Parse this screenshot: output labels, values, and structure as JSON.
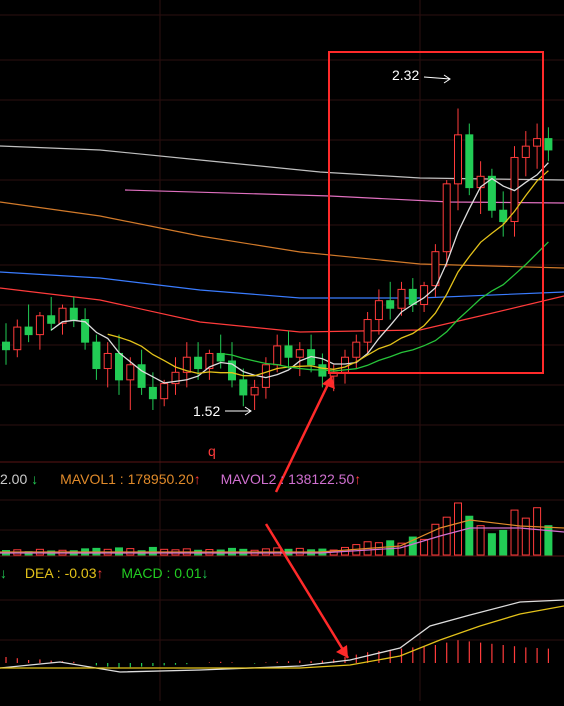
{
  "header_top": {
    "text": ""
  },
  "annotations": {
    "high_price": "2.32",
    "low_price": "1.52",
    "marker": "q"
  },
  "volume_header": {
    "prev_value": "2.00",
    "prev_arrow": "↓",
    "mavol1_label": "MAVOL1 : 178950.20",
    "mavol1_arrow": "↑",
    "mavol2_label": "MAVOL2 : 138122.50",
    "mavol2_arrow": "↑"
  },
  "macd_header": {
    "lead_arrow": "↓",
    "dea_label": "DEA : -0.03",
    "dea_arrow": "↑",
    "macd_label": "MACD : 0.01",
    "macd_arrow": "↓"
  },
  "colors": {
    "up": "#ff3b3b",
    "down": "#22cc55",
    "ma5": "#dddddd",
    "ma10": "#e3c21a",
    "ma20": "#27c43a",
    "ma30": "#e070c0",
    "ma60": "#3a7cff",
    "ma120": "#d27a2a",
    "ma250": "#c0c0c0",
    "highlight": "#ff2a2a",
    "mavol1": "#e08a2a",
    "mavol2": "#d070d0",
    "dea": "#e3c21a",
    "macd": "#22cc22"
  },
  "chart_data": {
    "type": "candlestick",
    "note": "",
    "candles": [
      {
        "o": 1.7,
        "h": 1.75,
        "l": 1.64,
        "c": 1.68
      },
      {
        "o": 1.68,
        "h": 1.76,
        "l": 1.66,
        "c": 1.74
      },
      {
        "o": 1.74,
        "h": 1.8,
        "l": 1.7,
        "c": 1.72
      },
      {
        "o": 1.72,
        "h": 1.78,
        "l": 1.68,
        "c": 1.77
      },
      {
        "o": 1.77,
        "h": 1.82,
        "l": 1.73,
        "c": 1.75
      },
      {
        "o": 1.75,
        "h": 1.8,
        "l": 1.72,
        "c": 1.79
      },
      {
        "o": 1.79,
        "h": 1.82,
        "l": 1.74,
        "c": 1.76
      },
      {
        "o": 1.76,
        "h": 1.79,
        "l": 1.68,
        "c": 1.7
      },
      {
        "o": 1.7,
        "h": 1.72,
        "l": 1.6,
        "c": 1.63
      },
      {
        "o": 1.63,
        "h": 1.7,
        "l": 1.58,
        "c": 1.67
      },
      {
        "o": 1.67,
        "h": 1.72,
        "l": 1.56,
        "c": 1.6
      },
      {
        "o": 1.6,
        "h": 1.66,
        "l": 1.52,
        "c": 1.64
      },
      {
        "o": 1.64,
        "h": 1.68,
        "l": 1.56,
        "c": 1.58
      },
      {
        "o": 1.58,
        "h": 1.62,
        "l": 1.52,
        "c": 1.55
      },
      {
        "o": 1.55,
        "h": 1.6,
        "l": 1.53,
        "c": 1.59
      },
      {
        "o": 1.59,
        "h": 1.66,
        "l": 1.56,
        "c": 1.62
      },
      {
        "o": 1.62,
        "h": 1.7,
        "l": 1.58,
        "c": 1.66
      },
      {
        "o": 1.66,
        "h": 1.7,
        "l": 1.6,
        "c": 1.63
      },
      {
        "o": 1.63,
        "h": 1.68,
        "l": 1.6,
        "c": 1.67
      },
      {
        "o": 1.67,
        "h": 1.72,
        "l": 1.63,
        "c": 1.65
      },
      {
        "o": 1.65,
        "h": 1.7,
        "l": 1.58,
        "c": 1.6
      },
      {
        "o": 1.6,
        "h": 1.63,
        "l": 1.53,
        "c": 1.56
      },
      {
        "o": 1.56,
        "h": 1.6,
        "l": 1.52,
        "c": 1.58
      },
      {
        "o": 1.58,
        "h": 1.66,
        "l": 1.55,
        "c": 1.64
      },
      {
        "o": 1.64,
        "h": 1.72,
        "l": 1.62,
        "c": 1.69
      },
      {
        "o": 1.69,
        "h": 1.73,
        "l": 1.63,
        "c": 1.66
      },
      {
        "o": 1.66,
        "h": 1.7,
        "l": 1.61,
        "c": 1.68
      },
      {
        "o": 1.68,
        "h": 1.72,
        "l": 1.62,
        "c": 1.64
      },
      {
        "o": 1.64,
        "h": 1.67,
        "l": 1.58,
        "c": 1.61
      },
      {
        "o": 1.61,
        "h": 1.64,
        "l": 1.57,
        "c": 1.62
      },
      {
        "o": 1.62,
        "h": 1.68,
        "l": 1.59,
        "c": 1.66
      },
      {
        "o": 1.66,
        "h": 1.72,
        "l": 1.63,
        "c": 1.7
      },
      {
        "o": 1.7,
        "h": 1.78,
        "l": 1.67,
        "c": 1.76
      },
      {
        "o": 1.76,
        "h": 1.84,
        "l": 1.72,
        "c": 1.81
      },
      {
        "o": 1.81,
        "h": 1.86,
        "l": 1.76,
        "c": 1.79
      },
      {
        "o": 1.79,
        "h": 1.86,
        "l": 1.77,
        "c": 1.84
      },
      {
        "o": 1.84,
        "h": 1.87,
        "l": 1.78,
        "c": 1.8
      },
      {
        "o": 1.8,
        "h": 1.86,
        "l": 1.78,
        "c": 1.85
      },
      {
        "o": 1.85,
        "h": 1.96,
        "l": 1.82,
        "c": 1.94
      },
      {
        "o": 1.94,
        "h": 2.13,
        "l": 1.9,
        "c": 2.12
      },
      {
        "o": 2.12,
        "h": 2.32,
        "l": 2.05,
        "c": 2.25
      },
      {
        "o": 2.25,
        "h": 2.28,
        "l": 2.09,
        "c": 2.11
      },
      {
        "o": 2.11,
        "h": 2.18,
        "l": 2.04,
        "c": 2.14
      },
      {
        "o": 2.14,
        "h": 2.16,
        "l": 2.03,
        "c": 2.05
      },
      {
        "o": 2.05,
        "h": 2.1,
        "l": 1.98,
        "c": 2.02
      },
      {
        "o": 2.02,
        "h": 2.22,
        "l": 1.98,
        "c": 2.19
      },
      {
        "o": 2.19,
        "h": 2.26,
        "l": 2.14,
        "c": 2.22
      },
      {
        "o": 2.22,
        "h": 2.28,
        "l": 2.16,
        "c": 2.24
      },
      {
        "o": 2.24,
        "h": 2.27,
        "l": 2.18,
        "c": 2.21
      }
    ],
    "volume": [
      95,
      110,
      70,
      120,
      85,
      100,
      90,
      130,
      140,
      120,
      150,
      135,
      90,
      160,
      120,
      110,
      130,
      100,
      115,
      105,
      140,
      120,
      100,
      130,
      150,
      120,
      140,
      110,
      125,
      105,
      160,
      220,
      280,
      260,
      300,
      250,
      380,
      330,
      650,
      800,
      1100,
      820,
      620,
      450,
      520,
      950,
      780,
      1000,
      620
    ],
    "macd_hist": [
      0.01,
      0.008,
      0.005,
      0.006,
      0.004,
      0.003,
      0.002,
      0.0,
      -0.004,
      -0.006,
      -0.008,
      -0.007,
      -0.006,
      -0.005,
      -0.004,
      -0.003,
      -0.002,
      0.0,
      0.001,
      0.002,
      0.001,
      0.0,
      -0.001,
      0.001,
      0.002,
      0.003,
      0.004,
      0.003,
      0.004,
      0.006,
      0.01,
      0.014,
      0.018,
      0.02,
      0.022,
      0.024,
      0.026,
      0.028,
      0.03,
      0.034,
      0.038,
      0.036,
      0.034,
      0.032,
      0.03,
      0.028,
      0.026,
      0.025,
      0.024
    ]
  }
}
